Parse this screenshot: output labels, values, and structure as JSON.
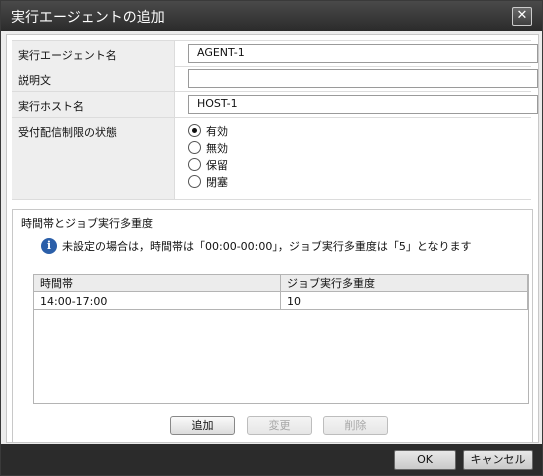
{
  "dialog": {
    "title": "実行エージェントの追加",
    "close_label": "✕"
  },
  "form": {
    "agent_name": {
      "label": "実行エージェント名",
      "value": "AGENT-1"
    },
    "description": {
      "label": "説明文",
      "value": ""
    },
    "host_name": {
      "label": "実行ホスト名",
      "value": "HOST-1"
    },
    "reception_status": {
      "label": "受付配信制限の状態",
      "options": [
        "有効",
        "無効",
        "保留",
        "閉塞"
      ],
      "selected": "有効"
    }
  },
  "concurrency_section": {
    "title": "時間帯とジョブ実行多重度",
    "info_icon": "info-icon",
    "info_text": "未設定の場合は，時間帯は「00:00-00:00」，ジョブ実行多重度は「5」となります",
    "columns": [
      "時間帯",
      "ジョブ実行多重度"
    ],
    "rows": [
      {
        "time": "14:00-17:00",
        "concurrency": "10"
      }
    ],
    "buttons": {
      "add": "追加",
      "edit": "変更",
      "delete": "削除"
    }
  },
  "footer": {
    "ok": "OK",
    "cancel": "キャンセル"
  }
}
